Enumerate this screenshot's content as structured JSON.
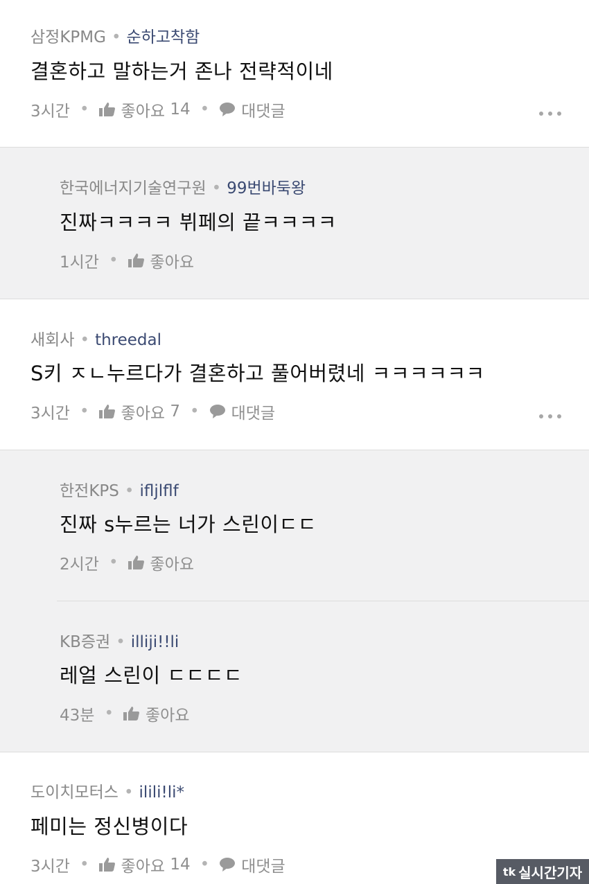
{
  "comments": [
    {
      "company": "삼정KPMG",
      "nick": "순하고착함",
      "text": "결혼하고 말하는거 존나 전략적이네",
      "time": "3시간",
      "like_label": "좋아요",
      "like_count": "14",
      "reply_label": "대댓글"
    },
    {
      "company": "한국에너지기술연구원",
      "nick": "99번바둑왕",
      "text": "진짜ㅋㅋㅋㅋ 뷔페의 끝ㅋㅋㅋㅋ",
      "time": "1시간",
      "like_label": "좋아요"
    },
    {
      "company": "새회사",
      "nick": "threedal",
      "text": "S키 ㅈㄴ누르다가 결혼하고 풀어버렸네 ㅋㅋㅋㅋㅋㅋ",
      "time": "3시간",
      "like_label": "좋아요",
      "like_count": "7",
      "reply_label": "대댓글"
    },
    {
      "company": "한전KPS",
      "nick": "ifljlflf",
      "text": "진짜 s누르는 너가 스린이ㄷㄷ",
      "time": "2시간",
      "like_label": "좋아요"
    },
    {
      "company": "KB증권",
      "nick": "illiji!!li",
      "text": "레얼 스린이 ㄷㄷㄷㄷ",
      "time": "43분",
      "like_label": "좋아요"
    },
    {
      "company": "도이치모터스",
      "nick": "ilili!li*",
      "text": "페미는 정신병이다",
      "time": "3시간",
      "like_label": "좋아요",
      "like_count": "14",
      "reply_label": "대댓글"
    }
  ],
  "watermark": {
    "logo": "tk",
    "text": "실시간기자"
  },
  "colors": {
    "nick": "#3b4a72",
    "company": "#888888",
    "reply_bg": "#f1f1f2",
    "meta": "#8f8f8f"
  }
}
